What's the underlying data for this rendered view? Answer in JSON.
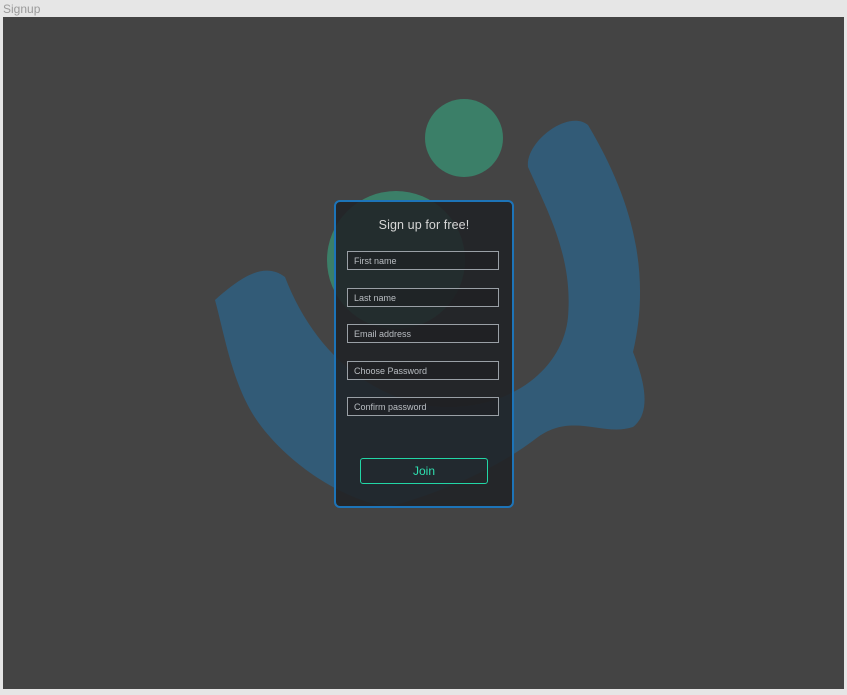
{
  "window": {
    "title": "Signup"
  },
  "colors": {
    "canvas_bg": "#444444",
    "card_border": "#1d74b8",
    "accent": "#22d6a6",
    "logo_blue": "#2f5f80",
    "logo_green": "#3a8a6e"
  },
  "form": {
    "title": "Sign up for free!",
    "fields": [
      {
        "name": "first-name",
        "placeholder": "First name",
        "value": ""
      },
      {
        "name": "last-name",
        "placeholder": "Last name",
        "value": ""
      },
      {
        "name": "email-address",
        "placeholder": "Email address",
        "value": ""
      },
      {
        "name": "choose-password",
        "placeholder": "Choose Password",
        "value": ""
      },
      {
        "name": "confirm-password",
        "placeholder": "Confirm password",
        "value": ""
      }
    ],
    "submit_label": "Join"
  }
}
